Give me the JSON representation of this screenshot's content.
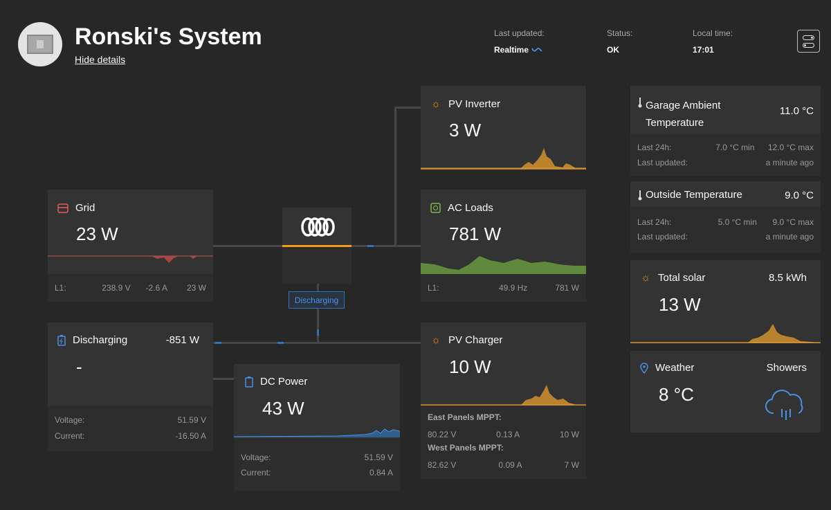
{
  "header": {
    "title": "Ronski's System",
    "hide_details": "Hide details",
    "last_updated_label": "Last updated:",
    "last_updated_value": "Realtime",
    "status_label": "Status:",
    "status_value": "OK",
    "local_time_label": "Local time:",
    "local_time_value": "17:01"
  },
  "grid": {
    "title": "Grid",
    "power": "23 W",
    "l1_label": "L1:",
    "voltage": "238.9 V",
    "current": "-2.6 A",
    "watts": "23 W"
  },
  "battery": {
    "title": "Discharging",
    "power": "-851 W",
    "soc": "-",
    "voltage_label": "Voltage:",
    "voltage": "51.59 V",
    "current_label": "Current:",
    "current": "-16.50 A"
  },
  "inverter": {
    "state": "Discharging"
  },
  "dc_power": {
    "title": "DC Power",
    "power": "43 W",
    "voltage_label": "Voltage:",
    "voltage": "51.59 V",
    "current_label": "Current:",
    "current": "0.84 A"
  },
  "pv_inverter": {
    "title": "PV Inverter",
    "power": "3 W"
  },
  "ac_loads": {
    "title": "AC Loads",
    "power": "781 W",
    "l1_label": "L1:",
    "freq": "49.9 Hz",
    "watts": "781 W"
  },
  "pv_charger": {
    "title": "PV Charger",
    "power": "10 W",
    "east_label": "East Panels MPPT:",
    "east_v": "80.22 V",
    "east_a": "0.13 A",
    "east_w": "10 W",
    "west_label": "West Panels MPPT:",
    "west_v": "82.62 V",
    "west_a": "0.09 A",
    "west_w": "7 W"
  },
  "garage": {
    "title_line1": "Garage Ambient",
    "title_line2": "Temperature",
    "value": "11.0 °C",
    "last24_label": "Last 24h:",
    "min": "7.0 °C min",
    "max": "12.0 °C max",
    "updated_label": "Last updated:",
    "updated": "a minute ago"
  },
  "outside": {
    "title": "Outside Temperature",
    "value": "9.0 °C",
    "last24_label": "Last 24h:",
    "min": "5.0 °C min",
    "max": "9.0 °C max",
    "updated_label": "Last updated:",
    "updated": "a minute ago"
  },
  "solar": {
    "title": "Total solar",
    "energy": "8.5 kWh",
    "power": "13 W"
  },
  "weather": {
    "title": "Weather",
    "condition": "Showers",
    "temp": "8 °C"
  },
  "icons": {
    "sun": "sun-icon",
    "grid": "grid-icon",
    "battery": "battery-icon",
    "plug": "plug-icon",
    "thermometer": "thermometer-icon",
    "location": "location-pin-icon",
    "cloud": "rain-cloud-icon"
  },
  "colors": {
    "accent_orange": "#f39c12",
    "solar_fill": "#b9822e",
    "load_fill": "#5f8a3e",
    "grid_fill": "#a84744",
    "dc_fill": "#2f5f8c",
    "flow_blue": "#2d73bd"
  }
}
